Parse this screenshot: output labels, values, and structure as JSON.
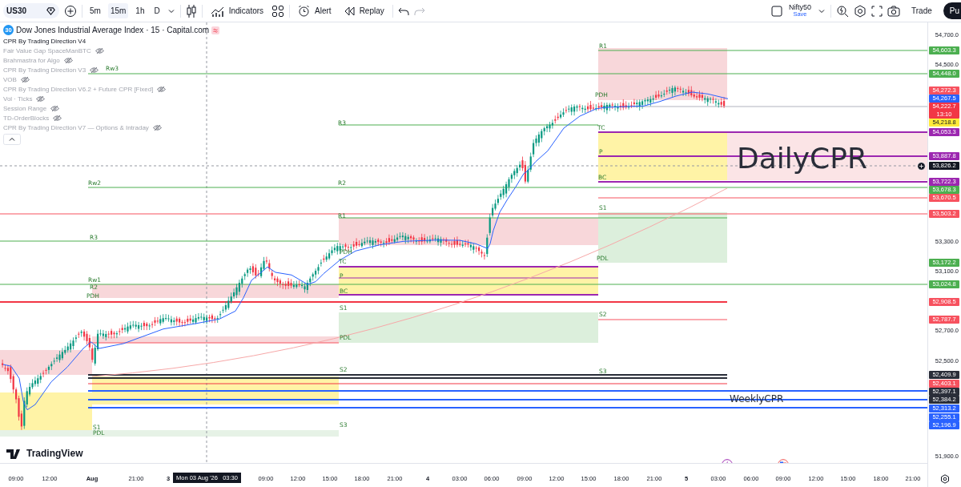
{
  "toolbar": {
    "symbol": "US30",
    "timeframes": [
      {
        "label": "5m",
        "selected": false
      },
      {
        "label": "15m",
        "selected": true
      },
      {
        "label": "1h",
        "selected": false
      },
      {
        "label": "D",
        "selected": false
      }
    ],
    "buttons": [
      {
        "kind": "indicators",
        "label": "Indicators"
      },
      {
        "kind": "alert",
        "label": "Alert"
      },
      {
        "kind": "replay",
        "label": "Replay"
      }
    ],
    "layout": {
      "name": "Nifty50",
      "status": "Save"
    },
    "trade": "Trade",
    "publish": "Pu"
  },
  "legend": {
    "badge": "30",
    "title": "Dow Jones Industrial Average Index · 15 · Capital.com",
    "indicators": [
      {
        "name": "CPR By Trading Direction V4",
        "hidden": false
      },
      {
        "name": "Fair Value Gap SpaceManBTC",
        "hidden": true
      },
      {
        "name": "Brahmastra for Algo",
        "hidden": true
      },
      {
        "name": "CPR By Trading Direction V3",
        "hidden": true
      },
      {
        "name": "VOB",
        "hidden": true
      },
      {
        "name": "CPR By Trading Direction V6.2 + Future CPR [Fixed]",
        "hidden": true
      },
      {
        "name": "Vol · Ticks",
        "hidden": true
      },
      {
        "name": "Session Range",
        "hidden": true
      },
      {
        "name": "TD-OrderBlocks",
        "hidden": true
      },
      {
        "name": "CPR By Trading Direction V7 — Options & Intraday",
        "hidden": true
      }
    ]
  },
  "chart": {
    "annotations": [
      "DailyCPR",
      "WeeklyCPR"
    ],
    "level_labels": [
      "R1",
      "Rw3",
      "PDH",
      "R3",
      "TC",
      "P",
      "BC",
      "Rw2",
      "R2",
      "S1",
      "R1",
      "R3",
      "PDH",
      "PDL",
      "TC",
      "P",
      "Rw1",
      "R2",
      "PDH",
      "BC",
      "S1",
      "S2",
      "PDL",
      "S2",
      "S3",
      "S3",
      "S1",
      "PDL"
    ]
  },
  "price_axis": {
    "scale": [
      "54,700.0",
      "54,500.0",
      "53,300.0",
      "53,100.0",
      "52,700.0",
      "52,500.0",
      "51,900.0"
    ],
    "tags": [
      {
        "text": "54,603.3",
        "color": "#4caf50"
      },
      {
        "text": "54,448.0",
        "color": "#4caf50"
      },
      {
        "text": "54,272.3",
        "color": "#f7525f"
      },
      {
        "text": "54,267.5",
        "color": "#2962ff"
      },
      {
        "text": "54,222.7",
        "sub": "13:10",
        "color": "#f23645"
      },
      {
        "text": "54,218.8",
        "color": "#ffeb3b"
      },
      {
        "text": "54,053.3",
        "color": "#9c27b0"
      },
      {
        "text": "53,887.8",
        "color": "#9c27b0"
      },
      {
        "text": "53,826.2",
        "color": "#131722"
      },
      {
        "text": "53,722.3",
        "color": "#9c27b0"
      },
      {
        "text": "53,678.3",
        "color": "#4caf50"
      },
      {
        "text": "53,670.5",
        "color": "#f7525f"
      },
      {
        "text": "53,503.2",
        "color": "#f7525f"
      },
      {
        "text": "53,172.2",
        "color": "#4caf50"
      },
      {
        "text": "53,024.8",
        "color": "#4caf50"
      },
      {
        "text": "52,908.5",
        "color": "#f7525f"
      },
      {
        "text": "52,787.7",
        "color": "#f7525f"
      },
      {
        "text": "52,409.9",
        "color": "#2a2e39"
      },
      {
        "text": "52,403.1",
        "color": "#f7525f"
      },
      {
        "text": "52,397.1",
        "color": "#2a2e39"
      },
      {
        "text": "52,384.2",
        "color": "#2a2e39"
      },
      {
        "text": "52,313.2",
        "color": "#2962ff"
      },
      {
        "text": "52,255.1",
        "color": "#2962ff"
      },
      {
        "text": "52,196.9",
        "color": "#2962ff"
      }
    ]
  },
  "time_axis": {
    "labels": [
      {
        "text": "09:00",
        "kind": "time"
      },
      {
        "text": "12:00",
        "kind": "time"
      },
      {
        "text": "Aug",
        "kind": "day"
      },
      {
        "text": "21:00",
        "kind": "time"
      },
      {
        "text": "3",
        "kind": "day"
      },
      {
        "text": "09:00",
        "kind": "time"
      },
      {
        "text": "12:00",
        "kind": "time"
      },
      {
        "text": "15:00",
        "kind": "time"
      },
      {
        "text": "18:00",
        "kind": "time"
      },
      {
        "text": "21:00",
        "kind": "time"
      },
      {
        "text": "4",
        "kind": "day"
      },
      {
        "text": "03:00",
        "kind": "time"
      },
      {
        "text": "06:00",
        "kind": "time"
      },
      {
        "text": "09:00",
        "kind": "time"
      },
      {
        "text": "12:00",
        "kind": "time"
      },
      {
        "text": "15:00",
        "kind": "time"
      },
      {
        "text": "18:00",
        "kind": "time"
      },
      {
        "text": "21:00",
        "kind": "time"
      },
      {
        "text": "5",
        "kind": "day"
      },
      {
        "text": "03:00",
        "kind": "time"
      },
      {
        "text": "06:00",
        "kind": "time"
      },
      {
        "text": "09:00",
        "kind": "time"
      },
      {
        "text": "12:00",
        "kind": "time"
      },
      {
        "text": "15:00",
        "kind": "time"
      },
      {
        "text": "18:00",
        "kind": "time"
      },
      {
        "text": "21:00",
        "kind": "time"
      }
    ],
    "crosshair": {
      "date": "Mon 03 Aug '26",
      "time": "03:30"
    }
  },
  "branding": "TradingView"
}
